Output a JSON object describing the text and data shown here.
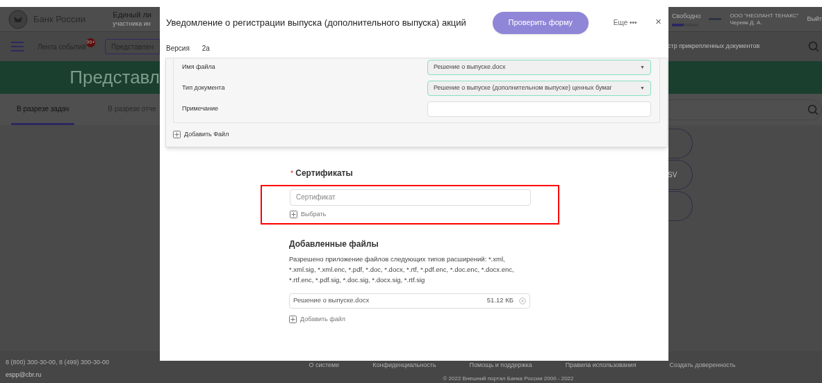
{
  "header": {
    "logo_text": "Банк России",
    "portal_title": "Единый ли",
    "portal_subtitle": "участника ин",
    "storage_label": "Свободно",
    "storage": {
      "level": 0.45
    },
    "company": "ООО \"НЕОЛАНТ ТЕНАКС\"",
    "user": "Черняк Д. А.",
    "logout": "Выйт"
  },
  "nav": {
    "feed": "Лента событий",
    "feed_badge": "99+",
    "submit_button": "Представлен",
    "registry": "стр прикрепленных документов"
  },
  "banner": {
    "title": "Представл"
  },
  "tabs": [
    {
      "label": "В разрезе задач",
      "selected": true
    },
    {
      "label": "В разрезе отче",
      "selected": false
    }
  ],
  "side_buttons": [
    {
      "kind": "empty"
    },
    {
      "kind": "labelled",
      "label": "SV"
    },
    {
      "kind": "empty"
    }
  ],
  "footer": {
    "phones": "8 (800) 300-30-00, 8 (499) 300-30-00",
    "email": "espp@cbr.ru",
    "links": [
      "О системе",
      "Конфиденциальность",
      "Помощь и поддержка",
      "Правила использования",
      "Создать доверенность"
    ],
    "copyright": "© 2022 Внешний портал Банка России 2000 - 2022"
  },
  "dialog": {
    "title": "Уведомление о регистрации выпуска (дополнительного выпуска) акций",
    "check_button": "Проверить форму",
    "more": "Еще •••",
    "close": "×",
    "version_label": "Версия",
    "version": "2а",
    "file_fields": [
      {
        "label": "Имя файла",
        "kind": "select",
        "value": "Решение о выпуске.docx",
        "caret": "▼"
      },
      {
        "label": "Тип документа",
        "kind": "select",
        "value": "Решение о выпуске (дополнительном выпуске) ценных бумаг",
        "caret": "▼"
      },
      {
        "label": "Примечание",
        "kind": "input"
      }
    ],
    "add_file_top": "Добавить Файл",
    "certificates": {
      "required_mark": "*",
      "title": "Сертификаты",
      "placeholder": "Сертификат",
      "choose": "Выбрать",
      "highlighted": true
    },
    "added_files": {
      "title": "Добавленные файлы",
      "description": "Разрешено приложение файлов следующих типов расширений: *.xml, *.xml.sig, *.xml.enc, *.pdf, *.doc, *.docx, *.rtf, *.pdf.enc, *.doc.enc, *.docx.enc, *.rtf.enc, *.pdf.sig, *.doc.sig, *.docx.sig, *.rtf.sig",
      "files": [
        {
          "name": "Решение о выпуске.docx",
          "size": "51.12 КБ"
        }
      ],
      "add": "Добавить файл"
    }
  }
}
